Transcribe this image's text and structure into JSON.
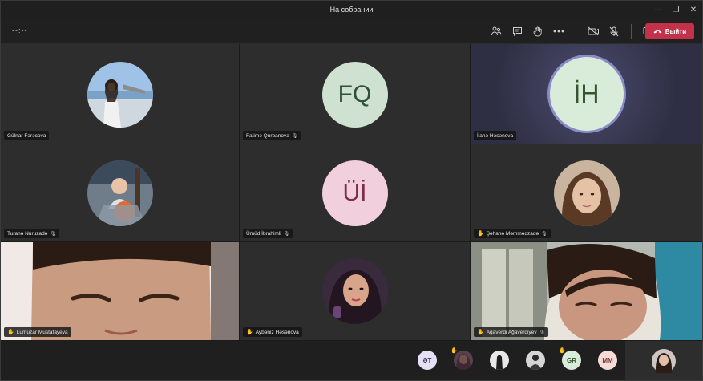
{
  "window": {
    "title": "На собрании",
    "controls": [
      "—",
      "❐",
      "✕"
    ]
  },
  "toolbar": {
    "timer": "--:--",
    "leave_label": "Выйти",
    "icons": [
      "people-icon",
      "chat-icon",
      "raise-hand-icon",
      "more-icon",
      "camera-off-icon",
      "mic-off-icon",
      "share-icon"
    ]
  },
  "colors": {
    "accent_red": "#c4314b",
    "hand_yellow": "#f2c744"
  },
  "participants": [
    {
      "name": "Gülnar Fərəcova",
      "hand": false,
      "mic_icon": false,
      "avatar": "photo"
    },
    {
      "name": "Fatimə Qurbanova",
      "hand": false,
      "mic_icon": true,
      "avatar": "initials",
      "initials": "FQ",
      "bg": "#cfe2d2",
      "fg": "#2e5137"
    },
    {
      "name": "İlahə Həsənova",
      "hand": false,
      "mic_icon": false,
      "avatar": "initials",
      "initials": "İH",
      "bg": "#d9ecd9",
      "fg": "#35542f",
      "speaking": true
    },
    {
      "name": "Turanə Nuruzadə",
      "hand": false,
      "mic_icon": true,
      "avatar": "photo"
    },
    {
      "name": "Ümüd İbrahimli",
      "hand": false,
      "mic_icon": true,
      "avatar": "initials",
      "initials": "Üİ",
      "bg": "#f2cfdc",
      "fg": "#7a2e48"
    },
    {
      "name": "Şəhanə Məmmədzadə",
      "hand": true,
      "mic_icon": true,
      "avatar": "photo"
    },
    {
      "name": "Lumuzar Mustafayeva",
      "hand": true,
      "mic_icon": false,
      "avatar": "video"
    },
    {
      "name": "Aybəniz Həsənova",
      "hand": true,
      "mic_icon": false,
      "avatar": "photo"
    },
    {
      "name": "Ağaverdi Ağaverdiyev",
      "hand": true,
      "mic_icon": true,
      "avatar": "video"
    }
  ],
  "overflow": [
    {
      "label": "ƏT",
      "type": "initials",
      "bg": "#e6e0f5",
      "fg": "#3c3a57",
      "hand": false
    },
    {
      "label": "",
      "type": "photo",
      "hand": true
    },
    {
      "label": "",
      "type": "photo",
      "hand": false
    },
    {
      "label": "",
      "type": "photo",
      "hand": false
    },
    {
      "label": "GR",
      "type": "initials",
      "bg": "#d9ecd9",
      "fg": "#35542f",
      "hand": true
    },
    {
      "label": "MM",
      "type": "initials",
      "bg": "#f6dcd9",
      "fg": "#7a3b33",
      "hand": false
    }
  ]
}
